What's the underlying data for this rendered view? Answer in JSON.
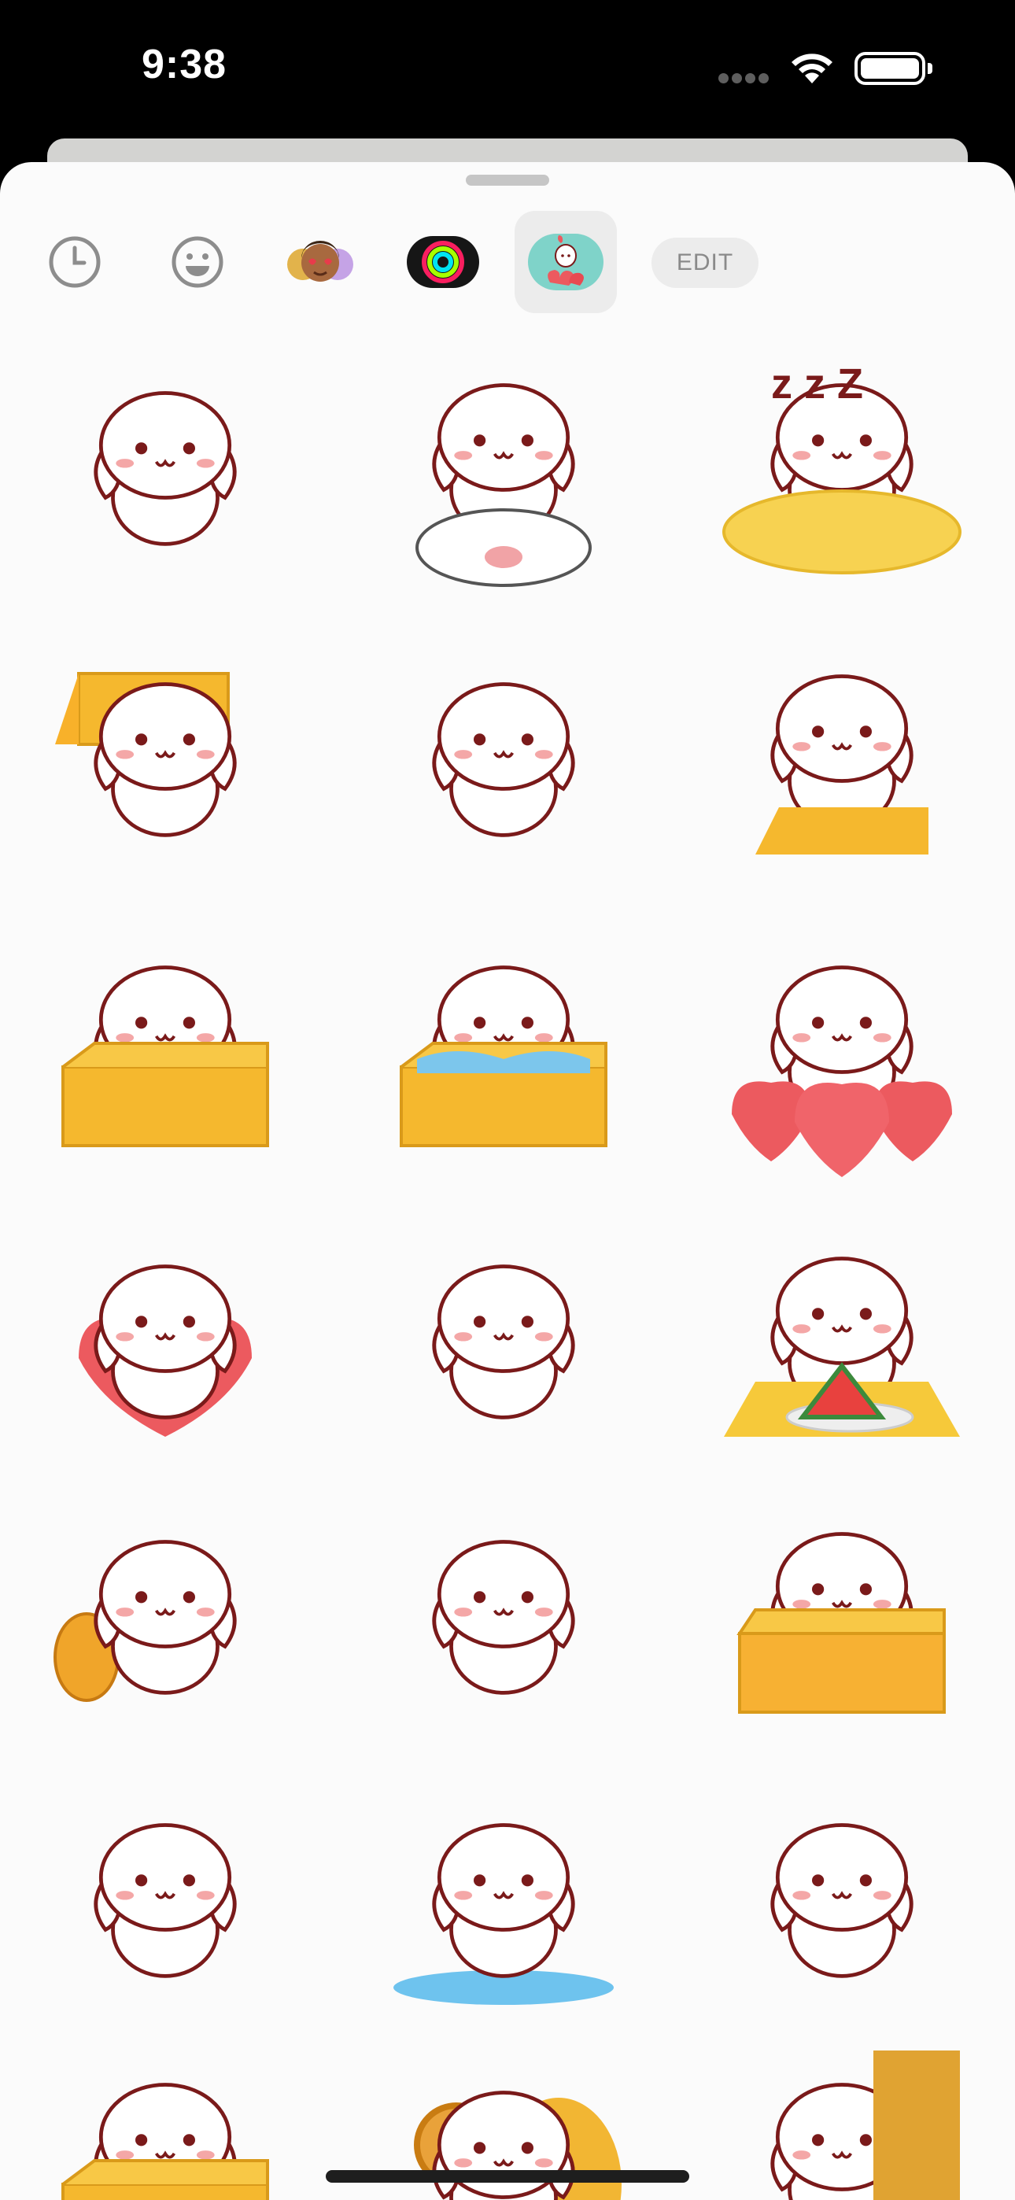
{
  "status_bar": {
    "time": "9:38"
  },
  "tabs": [
    {
      "name": "recents",
      "icon": "clock-icon"
    },
    {
      "name": "emoji",
      "icon": "smiley-icon"
    },
    {
      "name": "memoji",
      "icon": "memoji-icon"
    },
    {
      "name": "activity",
      "icon": "activity-rings-icon"
    },
    {
      "name": "puppy-sticker-pack",
      "icon": "puppy-pack-icon",
      "selected": true
    }
  ],
  "edit_button": {
    "label": "EDIT"
  },
  "stickers": [
    {
      "name": "sleepy-lean",
      "prop": "none"
    },
    {
      "name": "on-pig",
      "prop": "pig"
    },
    {
      "name": "zzz-pillow",
      "prop": "pillow",
      "text": "z z Z"
    },
    {
      "name": "box-on-head",
      "prop": "box-head"
    },
    {
      "name": "squint-lying",
      "prop": "none"
    },
    {
      "name": "peek-table",
      "prop": "table"
    },
    {
      "name": "in-box",
      "prop": "box"
    },
    {
      "name": "crying-box",
      "prop": "box-wet"
    },
    {
      "name": "hearts-pile",
      "prop": "hearts"
    },
    {
      "name": "holding-heart",
      "prop": "heart"
    },
    {
      "name": "sitting",
      "prop": "none"
    },
    {
      "name": "watermelon",
      "prop": "watermelon"
    },
    {
      "name": "backpack",
      "prop": "backpack"
    },
    {
      "name": "lying-tear",
      "prop": "none"
    },
    {
      "name": "picnic-basket",
      "prop": "basket"
    },
    {
      "name": "waving",
      "prop": "none"
    },
    {
      "name": "crying-puddle",
      "prop": "puddle"
    },
    {
      "name": "thinking",
      "prop": "none"
    },
    {
      "name": "box-peek",
      "prop": "box"
    },
    {
      "name": "headphones",
      "prop": "headphones"
    },
    {
      "name": "door-peek",
      "prop": "door"
    }
  ],
  "colors": {
    "sheet_bg": "#fbfbfb",
    "outline": "#7a1a1a",
    "cheek": "#f4a7a7",
    "box": "#f5b82e",
    "heart": "#ec5a5f"
  }
}
